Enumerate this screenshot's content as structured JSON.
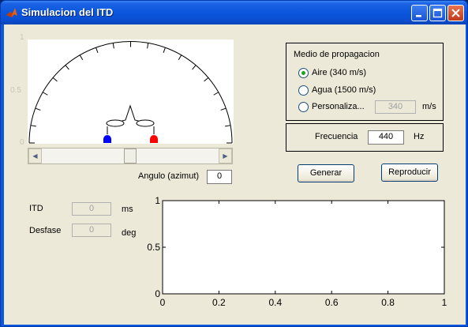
{
  "window": {
    "title": "Simulacion del ITD"
  },
  "medio": {
    "title": "Medio de propagacion",
    "options": [
      {
        "label": "Aire (340 m/s)",
        "selected": true
      },
      {
        "label": "Agua (1500 m/s)",
        "selected": false
      },
      {
        "label": "Personaliza...",
        "selected": false
      }
    ],
    "custom_value": "340",
    "custom_unit": "m/s"
  },
  "frecuencia": {
    "label": "Frecuencia",
    "value": "440",
    "unit": "Hz"
  },
  "buttons": {
    "generar": "Generar",
    "reproducir": "Reproducir"
  },
  "angulo": {
    "label": "Angulo (azimut)",
    "value": "0",
    "slider_fraction": 0.5
  },
  "itd": {
    "label": "ITD",
    "value": "0",
    "unit": "ms"
  },
  "desfase": {
    "label": "Desfase",
    "value": "0",
    "unit": "deg"
  },
  "top_axis_ticks": [
    "1",
    "0.5",
    "0"
  ],
  "plot": {
    "x_ticks": [
      "0",
      "0.2",
      "0.4",
      "0.6",
      "0.8",
      "1"
    ],
    "y_ticks": [
      "0",
      "0.5",
      "1"
    ]
  },
  "colors": {
    "left_ear": "#0000ff",
    "right_ear": "#ff0000"
  }
}
